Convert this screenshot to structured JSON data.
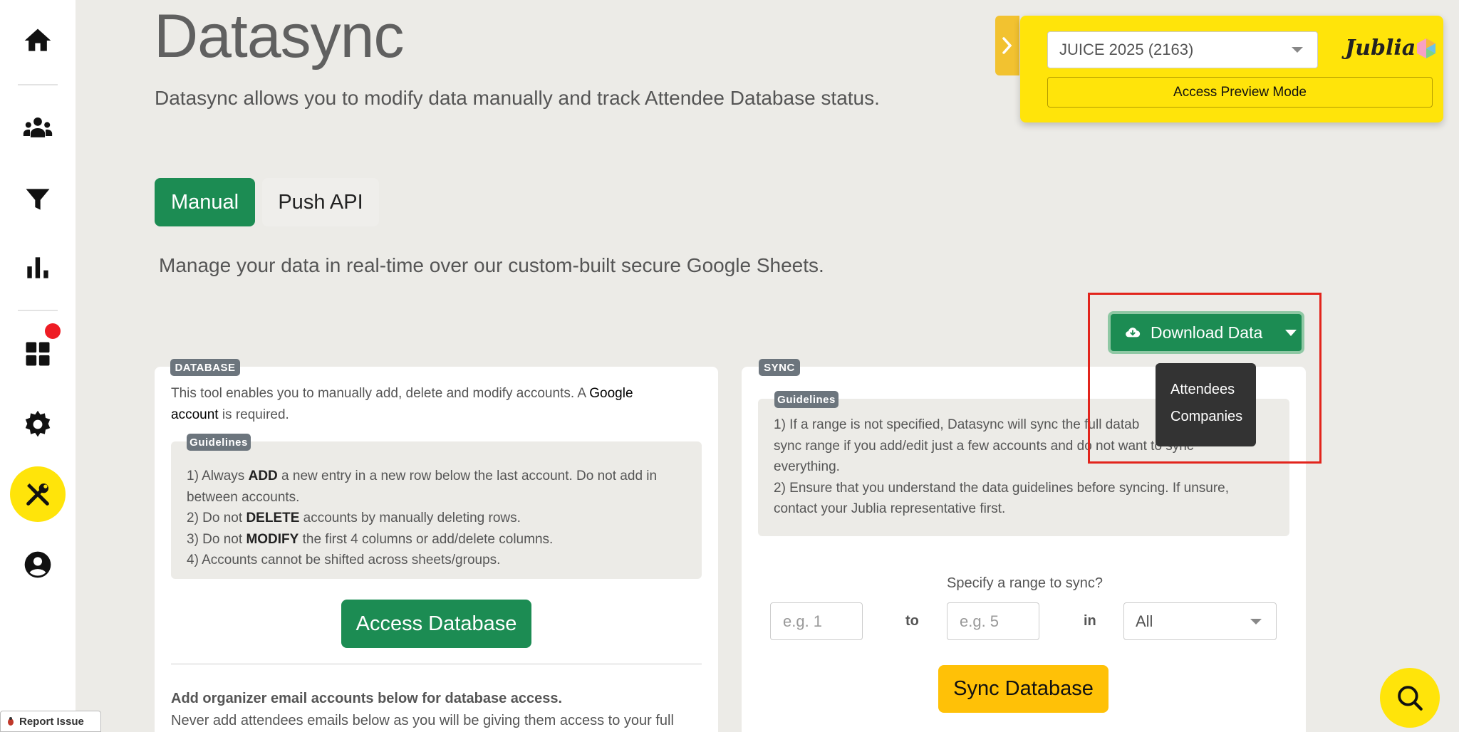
{
  "page": {
    "title": "Datasync",
    "subtitle": "Datasync allows you to modify data manually and track Attendee Database status."
  },
  "tabs": [
    {
      "label": "Manual",
      "active": true
    },
    {
      "label": "Push API",
      "active": false
    }
  ],
  "manage_text": "Manage your data in real-time over our custom-built secure Google Sheets.",
  "download": {
    "label": "Download Data",
    "menu": [
      "Attendees",
      "Companies"
    ]
  },
  "preview": {
    "event_selected": "JUICE 2025 (2163)",
    "access_preview_label": "Access Preview Mode",
    "logo_text": "Jublia"
  },
  "database_card": {
    "tag": "DATABASE",
    "intro_1": "This tool enables you to manually add, delete and modify accounts. A ",
    "intro_link_1": "Google",
    "intro_link_2": "account",
    "intro_2": " is required.",
    "guidelines_tag": "Guidelines",
    "guidelines": [
      {
        "pre": "1) Always ",
        "bold": "ADD",
        "post": " a new entry in a new row below the last account. Do not add in"
      },
      {
        "pre": "between accounts.",
        "bold": "",
        "post": ""
      },
      {
        "pre": "2) Do not ",
        "bold": "DELETE",
        "post": " accounts by manually deleting rows."
      },
      {
        "pre": "3) Do not ",
        "bold": "MODIFY",
        "post": " the first 4 columns or add/delete columns."
      },
      {
        "pre": "4) Accounts cannot be shifted across sheets/groups.",
        "bold": "",
        "post": ""
      }
    ],
    "access_button": "Access Database",
    "organizer_title": "Add organizer email accounts below for database access.",
    "organizer_note": "Never add attendees emails below as you will be giving them access to your full"
  },
  "sync_card": {
    "tag": "SYNC",
    "guidelines_tag": "Guidelines",
    "guidelines": [
      "1) If a range is not specified, Datasync will sync the full datab",
      "sync range if you add/edit just a few accounts and do not want to sync",
      "everything.",
      "2) Ensure that you understand the data guidelines before syncing. If unsure,",
      "contact your Jublia representative first."
    ],
    "range_label": "Specify a range to sync?",
    "from_placeholder": "e.g. 1",
    "to_word": "to",
    "to_placeholder": "e.g. 5",
    "in_word": "in",
    "group_selected": "All",
    "sync_button": "Sync Database"
  },
  "report_issue": "Report Issue",
  "colors": {
    "brand_green": "#1c8c53",
    "brand_yellow": "#ffe40a",
    "sync_yellow": "#ffc107",
    "highlight_red": "#e2241c"
  }
}
